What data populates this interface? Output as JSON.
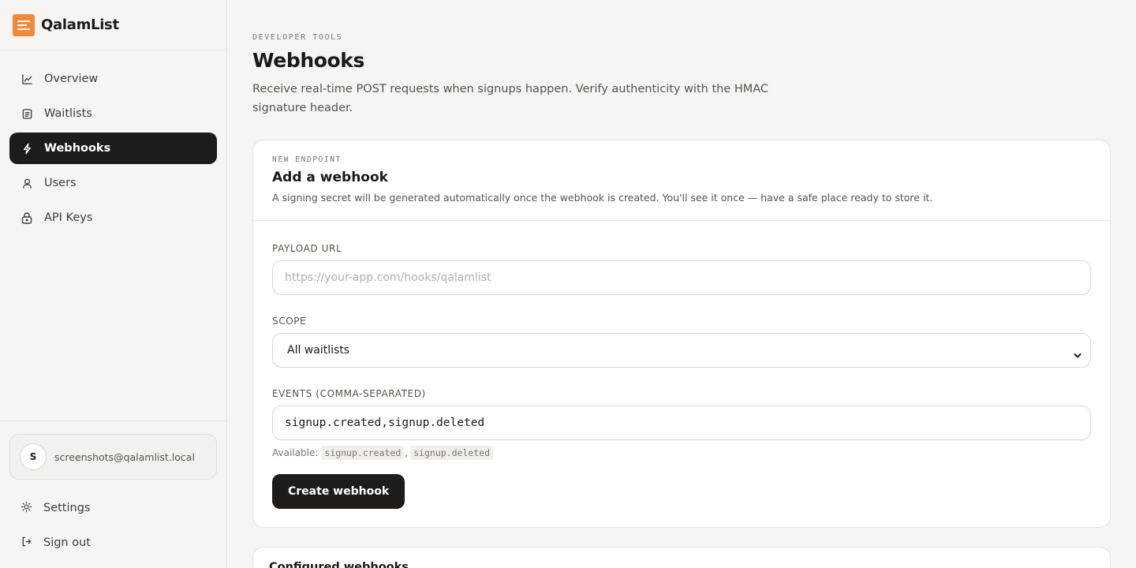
{
  "brand": {
    "name": "QalamList"
  },
  "sidebar": {
    "items": [
      {
        "label": "Overview",
        "icon": "chart-line-icon"
      },
      {
        "label": "Waitlists",
        "icon": "list-icon"
      },
      {
        "label": "Webhooks",
        "icon": "bolt-icon",
        "active": true
      },
      {
        "label": "Users",
        "icon": "user-icon"
      },
      {
        "label": "API Keys",
        "icon": "lock-icon"
      }
    ],
    "user": {
      "initial": "S",
      "email": "screenshots@qalamlist.local"
    },
    "settings_label": "Settings",
    "signout_label": "Sign out"
  },
  "header": {
    "eyebrow": "DEVELOPER TOOLS",
    "title": "Webhooks",
    "description": "Receive real-time POST requests when signups happen. Verify authenticity with the HMAC signature header."
  },
  "form_card": {
    "eyebrow": "NEW ENDPOINT",
    "title": "Add a webhook",
    "description": "A signing secret will be generated automatically once the webhook is created. You'll see it once — have a safe place ready to store it.",
    "payload_url": {
      "label": "PAYLOAD URL",
      "placeholder": "https://your-app.com/hooks/qalamlist",
      "value": ""
    },
    "scope": {
      "label": "SCOPE",
      "selected": "All waitlists"
    },
    "events": {
      "label": "EVENTS (COMMA-SEPARATED)",
      "value": "signup.created,signup.deleted",
      "available_label": "Available:",
      "available": [
        "signup.created",
        "signup.deleted"
      ],
      "separator": ","
    },
    "submit_label": "Create webhook"
  },
  "configured_card": {
    "title": "Configured webhooks"
  },
  "colors": {
    "accent": "#f1893b",
    "dark": "#1f1b18",
    "background": "#f6f5f3"
  }
}
